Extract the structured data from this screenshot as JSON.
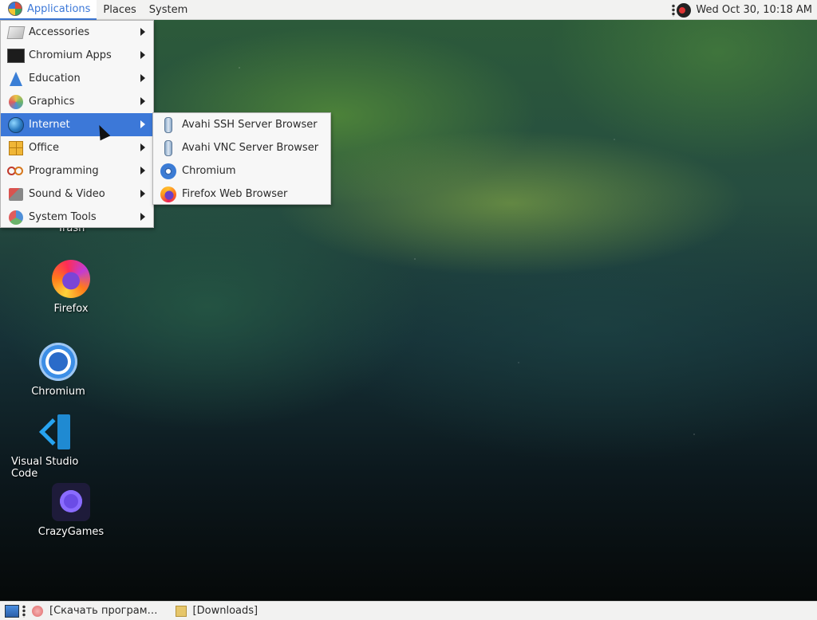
{
  "top_panel": {
    "applications_label": "Applications",
    "places_label": "Places",
    "system_label": "System",
    "clock": "Wed Oct 30, 10:18 AM"
  },
  "apps_menu": {
    "items": [
      {
        "label": "Accessories",
        "icon": "accessories-icon"
      },
      {
        "label": "Chromium Apps",
        "icon": "chromium-apps-icon"
      },
      {
        "label": "Education",
        "icon": "education-icon"
      },
      {
        "label": "Graphics",
        "icon": "graphics-icon"
      },
      {
        "label": "Internet",
        "icon": "internet-globe-icon",
        "active": true
      },
      {
        "label": "Office",
        "icon": "office-icon"
      },
      {
        "label": "Programming",
        "icon": "programming-icon"
      },
      {
        "label": "Sound & Video",
        "icon": "sound-video-icon"
      },
      {
        "label": "System Tools",
        "icon": "system-tools-icon"
      }
    ]
  },
  "internet_submenu": {
    "items": [
      {
        "label": "Avahi SSH Server Browser",
        "icon": "avahi-icon"
      },
      {
        "label": "Avahi VNC Server Browser",
        "icon": "avahi-icon"
      },
      {
        "label": "Chromium",
        "icon": "chromium-icon"
      },
      {
        "label": "Firefox Web Browser",
        "icon": "firefox-icon"
      }
    ]
  },
  "desktop_icons": {
    "trash": "Trash",
    "firefox": "Firefox",
    "chromium": "Chromium",
    "vscode": "Visual Studio Code",
    "crazygames": "CrazyGames"
  },
  "taskbar": {
    "tasks": [
      {
        "label": "[Скачать програм…",
        "icon": "browser-icon"
      },
      {
        "label": "[Downloads]",
        "icon": "folder-icon"
      }
    ]
  },
  "colors": {
    "accent": "#3c78d8",
    "panel_bg": "#f2f2f1"
  }
}
